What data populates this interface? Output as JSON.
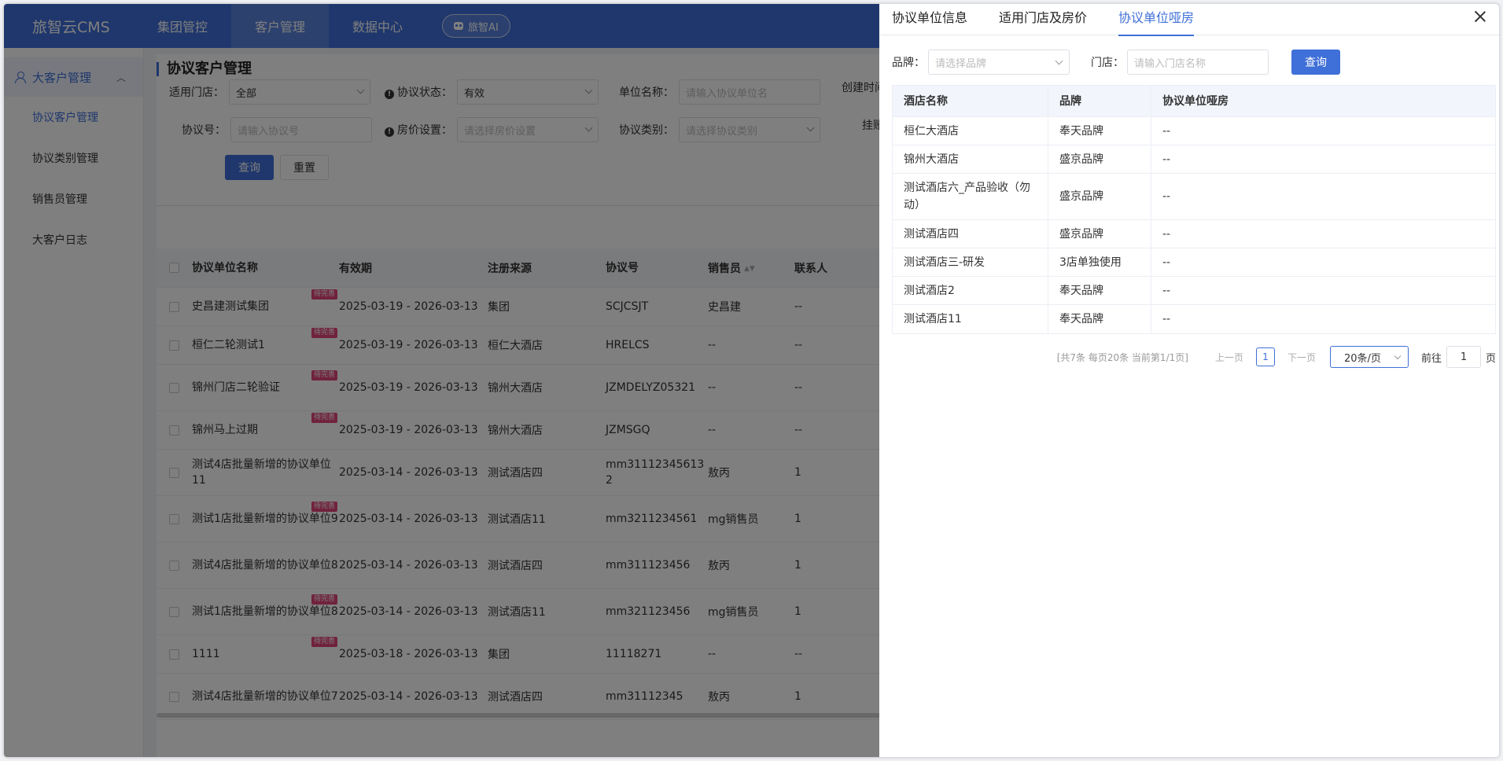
{
  "header": {
    "logo": "旅智云CMS",
    "nav": [
      "集团管控",
      "客户管理",
      "数据中心"
    ],
    "ai_label": "旅智AI"
  },
  "sidebar": {
    "group": "大客户管理",
    "items": [
      "协议客户管理",
      "协议类别管理",
      "销售员管理",
      "大客户日志"
    ]
  },
  "main": {
    "title": "协议客户管理",
    "filters": {
      "store_label": "适用门店：",
      "store_value": "全部",
      "status_label": "协议状态：",
      "status_value": "有效",
      "unit_label": "单位名称：",
      "unit_placeholder": "请输入协议单位名",
      "created_label": "创建时间",
      "no_label": "协议号：",
      "no_placeholder": "请输入协议号",
      "price_label": "房价设置：",
      "price_placeholder": "请选择房价设置",
      "type_label": "协议类别：",
      "type_placeholder": "请选择协议类别",
      "hang_label": "挂账"
    },
    "query_btn": "查询",
    "reset_btn": "重置",
    "table": {
      "headers": [
        "协议单位名称",
        "有效期",
        "注册来源",
        "协议号",
        "销售员",
        "联系人"
      ],
      "tag": "待完善",
      "rows": [
        {
          "name": "史昌建测试集团",
          "date": "2025-03-19 - 2026-03-13",
          "src": "集团",
          "no": "SCJCSJT",
          "sales": "史昌建",
          "contact": "--"
        },
        {
          "name": "桓仁二轮测试1",
          "date": "2025-03-19 - 2026-03-13",
          "src": "桓仁大酒店",
          "no": "HRELCS",
          "sales": "--",
          "contact": "--"
        },
        {
          "name": "锦州门店二轮验证",
          "date": "2025-03-19 - 2026-03-13",
          "src": "锦州大酒店",
          "no": "JZMDELYZ05321",
          "sales": "--",
          "contact": "--"
        },
        {
          "name": "锦州马上过期",
          "date": "2025-03-19 - 2026-03-13",
          "src": "锦州大酒店",
          "no": "JZMSGQ",
          "sales": "--",
          "contact": "--"
        },
        {
          "name": "测试4店批量新增的协议单位11",
          "date": "2025-03-14 - 2026-03-13",
          "src": "测试酒店四",
          "no": "mm311123456132",
          "sales": "敖丙",
          "contact": "1"
        },
        {
          "name": "测试1店批量新增的协议单位9",
          "date": "2025-03-14 - 2026-03-13",
          "src": "测试酒店11",
          "no": "mm3211234561",
          "sales": "mg销售员",
          "contact": "1"
        },
        {
          "name": "测试4店批量新增的协议单位8",
          "date": "2025-03-14 - 2026-03-13",
          "src": "测试酒店四",
          "no": "mm311123456",
          "sales": "敖丙",
          "contact": "1"
        },
        {
          "name": "测试1店批量新增的协议单位8",
          "date": "2025-03-14 - 2026-03-13",
          "src": "测试酒店11",
          "no": "mm321123456",
          "sales": "mg销售员",
          "contact": "1"
        },
        {
          "name": "1111",
          "date": "2025-03-18 - 2026-03-13",
          "src": "集团",
          "no": "11118271",
          "sales": "--",
          "contact": "--"
        },
        {
          "name": "测试4店批量新增的协议单位7",
          "date": "2025-03-14 - 2026-03-13",
          "src": "测试酒店四",
          "no": "mm31112345",
          "sales": "敖丙",
          "contact": "1"
        }
      ]
    }
  },
  "drawer": {
    "tabs": [
      "协议单位信息",
      "适用门店及房价",
      "协议单位哑房"
    ],
    "active_tab": 2,
    "brand_label": "品牌：",
    "brand_placeholder": "请选择品牌",
    "store_label": "门店：",
    "store_placeholder": "请输入门店名称",
    "query_btn": "查询",
    "table": {
      "headers": [
        "酒店名称",
        "品牌",
        "协议单位哑房"
      ],
      "rows": [
        {
          "hotel": "桓仁大酒店",
          "brand": "奉天品牌",
          "dumb": "--"
        },
        {
          "hotel": "锦州大酒店",
          "brand": "盛京品牌",
          "dumb": "--"
        },
        {
          "hotel": "测试酒店六_产品验收（勿动）",
          "brand": "盛京品牌",
          "dumb": "--"
        },
        {
          "hotel": "测试酒店四",
          "brand": "盛京品牌",
          "dumb": "--"
        },
        {
          "hotel": "测试酒店三-研发",
          "brand": "3店单独使用",
          "dumb": "--"
        },
        {
          "hotel": "测试酒店2",
          "brand": "奉天品牌",
          "dumb": "--"
        },
        {
          "hotel": "测试酒店11",
          "brand": "奉天品牌",
          "dumb": "--"
        }
      ]
    },
    "pager": {
      "total": "[共7条 每页20条 当前第1/1页]",
      "prev": "上一页",
      "page": "1",
      "next": "下一页",
      "size": "20条/页",
      "goto_before": "前往",
      "goto_value": "1",
      "goto_after": "页"
    }
  }
}
